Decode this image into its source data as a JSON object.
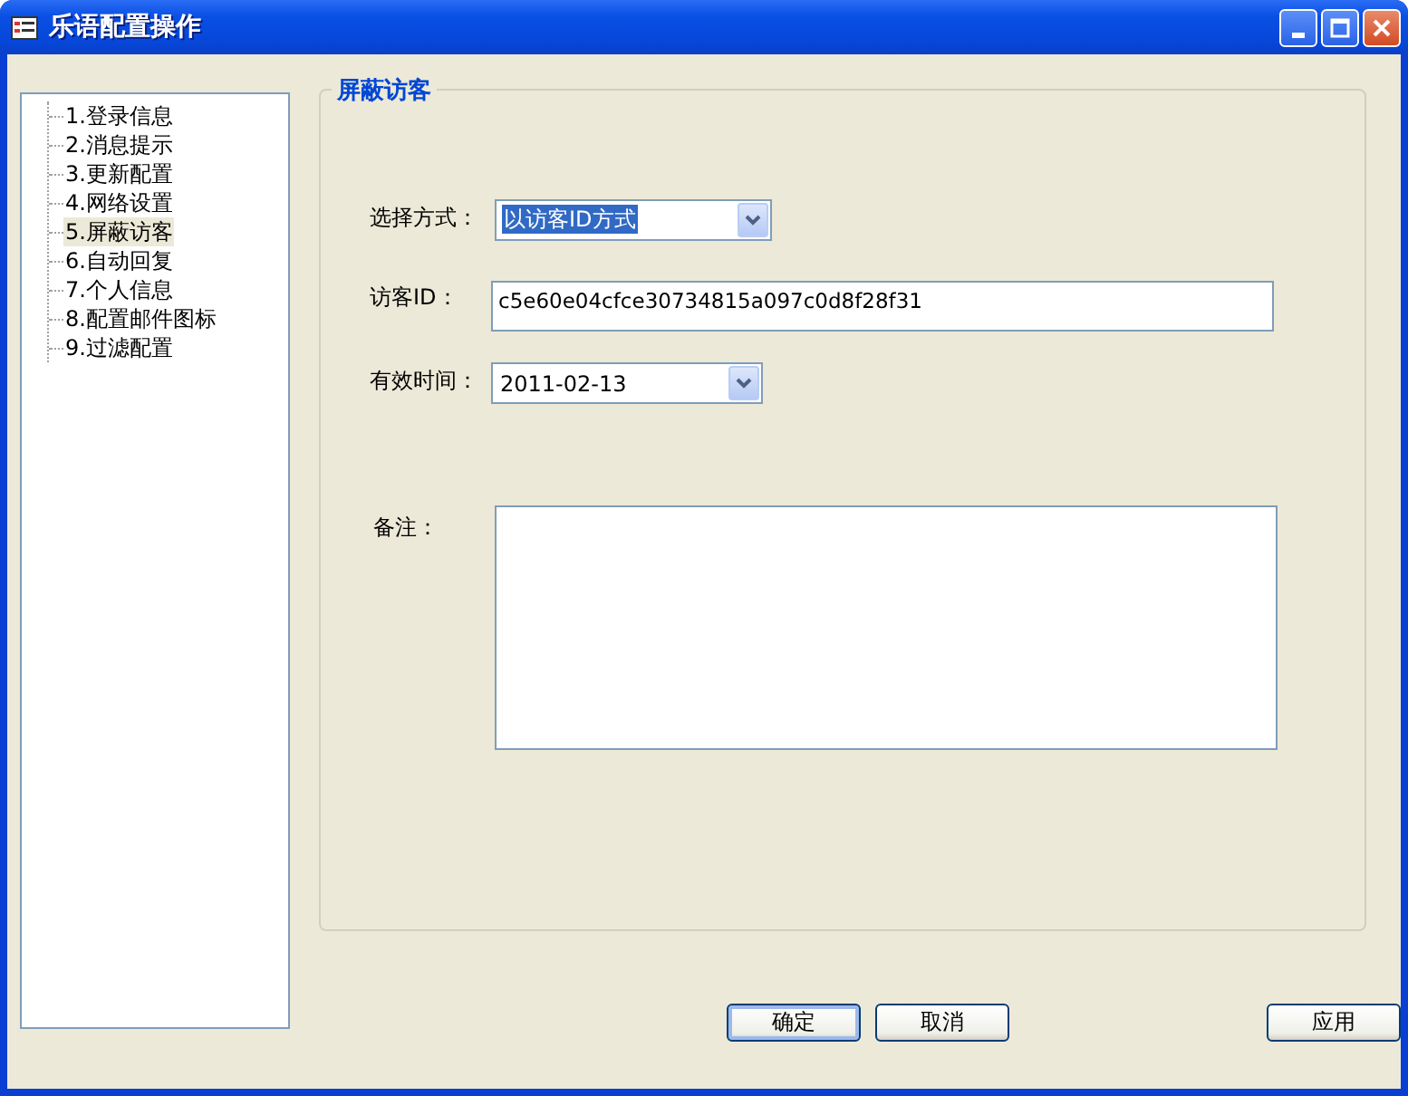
{
  "window": {
    "title": "乐语配置操作"
  },
  "sidebar": {
    "items": [
      {
        "label": "1.登录信息",
        "selected": false
      },
      {
        "label": "2.消息提示",
        "selected": false
      },
      {
        "label": "3.更新配置",
        "selected": false
      },
      {
        "label": "4.网络设置",
        "selected": false
      },
      {
        "label": "5.屏蔽访客",
        "selected": true
      },
      {
        "label": "6.自动回复",
        "selected": false
      },
      {
        "label": "7.个人信息",
        "selected": false
      },
      {
        "label": "8.配置邮件图标",
        "selected": false
      },
      {
        "label": "9.过滤配置",
        "selected": false
      }
    ]
  },
  "group": {
    "title": "屏蔽访客",
    "fields": [
      {
        "kind": "select",
        "label": "选择方式：",
        "value": "以访客ID方式",
        "value_selected": true
      },
      {
        "kind": "text",
        "label": "访客ID：",
        "value": "c5e60e04cfce30734815a097c0d8f28f31"
      },
      {
        "kind": "select",
        "label": "有效时间：",
        "value": "2011-02-13",
        "value_selected": false
      },
      {
        "kind": "textarea",
        "label": "备注："
      }
    ]
  },
  "buttons": [
    {
      "label": "确定",
      "default": true
    },
    {
      "label": "取消",
      "default": false
    },
    {
      "label": "应用",
      "default": false
    }
  ]
}
